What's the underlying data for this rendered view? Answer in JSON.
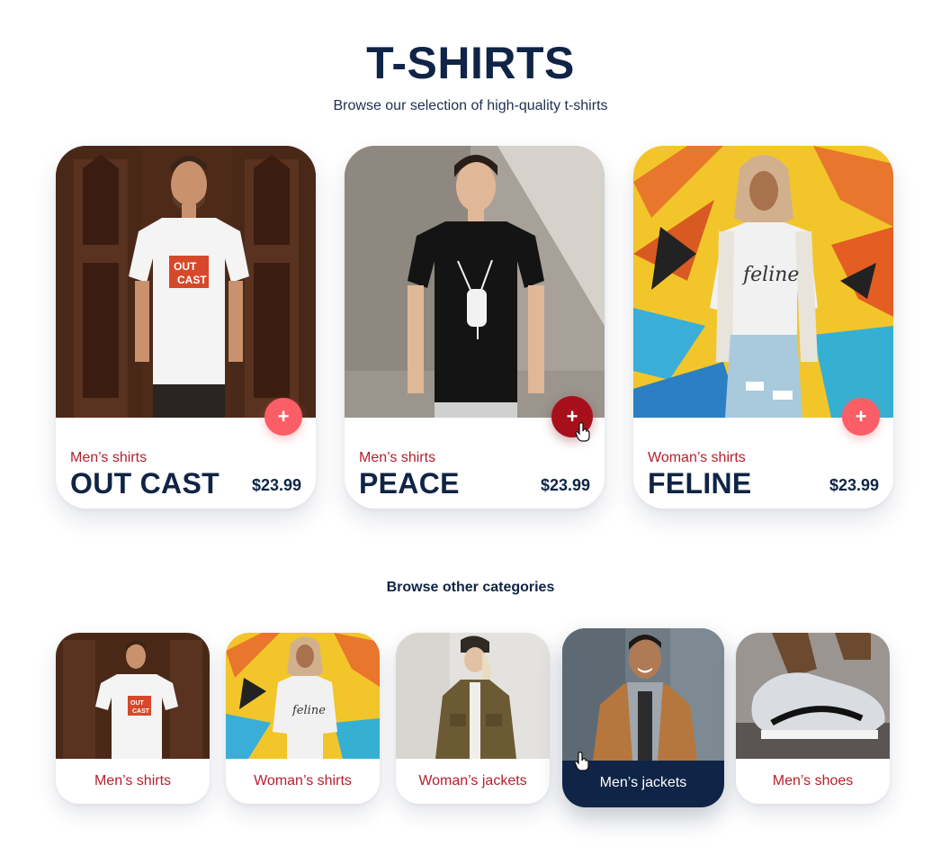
{
  "header": {
    "title": "T-SHIRTS",
    "subtitle": "Browse our selection of high-quality t-shirts"
  },
  "products": [
    {
      "category": "Men’s shirts",
      "name": "OUT CAST",
      "price": "$23.99",
      "add_label": "+",
      "print_text": [
        "OUT",
        "CAST"
      ]
    },
    {
      "category": "Men’s shirts",
      "name": "PEACE",
      "price": "$23.99",
      "add_label": "+"
    },
    {
      "category": "Woman’s shirts",
      "name": "FELINE",
      "price": "$23.99",
      "add_label": "+",
      "print_text": "feline"
    }
  ],
  "other_categories": {
    "title": "Browse other categories",
    "items": [
      {
        "label": "Men’s shirts"
      },
      {
        "label": "Woman’s shirts"
      },
      {
        "label": "Woman’s jackets"
      },
      {
        "label": "Men’s jackets"
      },
      {
        "label": "Men’s shoes"
      }
    ]
  },
  "colors": {
    "navy": "#0f2446",
    "accent_red": "#b51f2c",
    "add_button": "#fb5e66",
    "add_button_active": "#a7101a",
    "background": "#ffffff"
  }
}
